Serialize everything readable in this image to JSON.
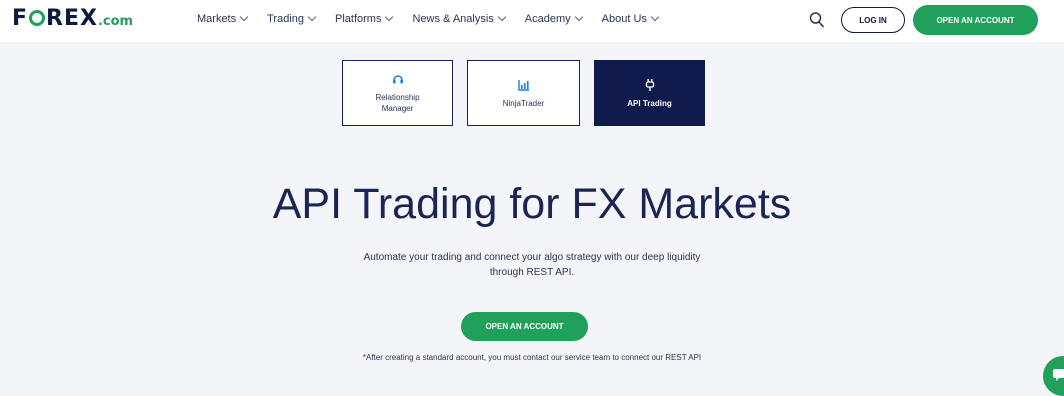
{
  "header": {
    "logo": {
      "main_before": "F",
      "main_after": "REX",
      "suffix": ".com"
    },
    "menu": [
      {
        "label": "Markets"
      },
      {
        "label": "Trading"
      },
      {
        "label": "Platforms"
      },
      {
        "label": "News & Analysis"
      },
      {
        "label": "Academy"
      },
      {
        "label": "About Us"
      }
    ],
    "search_icon": "search-icon",
    "login_label": "LOG IN",
    "open_account_label": "OPEN AN ACCOUNT"
  },
  "platform_tabs": [
    {
      "label": "Relationship Manager",
      "icon": "headset-icon",
      "active": false
    },
    {
      "label": "NinjaTrader",
      "icon": "chart-icon",
      "active": false
    },
    {
      "label": "API Trading",
      "icon": "plug-icon",
      "active": true
    }
  ],
  "hero": {
    "title": "API Trading for FX Markets",
    "subtitle_line1": "Automate your trading and connect your algo strategy with our deep liquidity",
    "subtitle_line2": "through REST API.",
    "cta_label": "OPEN AN ACCOUNT",
    "note": "*After creating a standard account, you must contact our service team to connect our REST API"
  },
  "colors": {
    "brand_green": "#1fa05b",
    "navy": "#101a4c",
    "background": "#f4f5f8"
  }
}
